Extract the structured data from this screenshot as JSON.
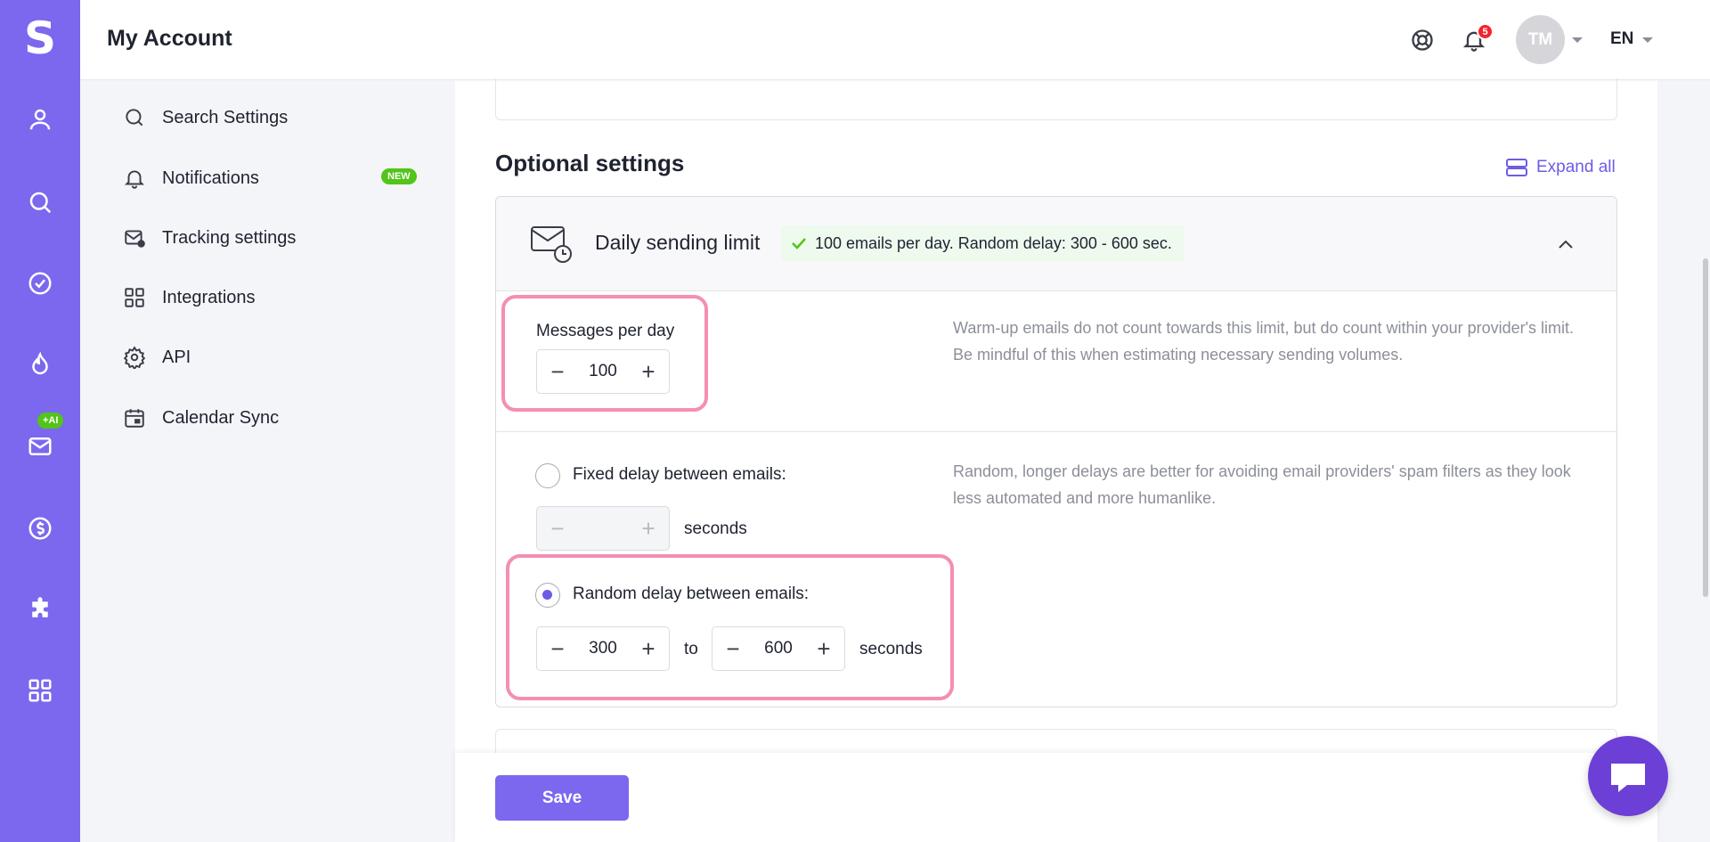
{
  "app": {
    "logo": "S",
    "ai_badge": "+AI"
  },
  "header": {
    "title": "My Account",
    "notification_count": "5",
    "avatar_initials": "TM",
    "language": "EN"
  },
  "sidebar": {
    "items": [
      {
        "label": "Search Settings",
        "icon": "search-icon"
      },
      {
        "label": "Notifications",
        "icon": "bell-icon",
        "badge": "NEW"
      },
      {
        "label": "Tracking settings",
        "icon": "envelope-tracking-icon"
      },
      {
        "label": "Integrations",
        "icon": "grid-icon"
      },
      {
        "label": "API",
        "icon": "gear-icon"
      },
      {
        "label": "Calendar Sync",
        "icon": "calendar-icon"
      }
    ]
  },
  "optional": {
    "title": "Optional settings",
    "expand_all": "Expand all"
  },
  "daily_limit": {
    "title": "Daily sending limit",
    "status": "100 emails per day. Random delay: 300 - 600 sec.",
    "messages_label": "Messages per day",
    "messages_value": "100",
    "messages_help": "Warm-up emails do not count towards this limit, but do count within your provider's limit. Be mindful of this when estimating necessary sending volumes.",
    "fixed_label": "Fixed delay between emails:",
    "fixed_value": "",
    "seconds": "seconds",
    "delay_help": "Random, longer delays are better for avoiding email providers' spam filters as they look less automated and more humanlike.",
    "random_label": "Random delay between emails:",
    "random_from": "300",
    "to_label": "to",
    "random_to": "600",
    "selected_mode": "random"
  },
  "footer": {
    "save_label": "Save"
  },
  "colors": {
    "brand": "#7b68ee",
    "accent": "#6c5ce7",
    "highlight": "#f48fb1",
    "success": "#52c41a"
  }
}
